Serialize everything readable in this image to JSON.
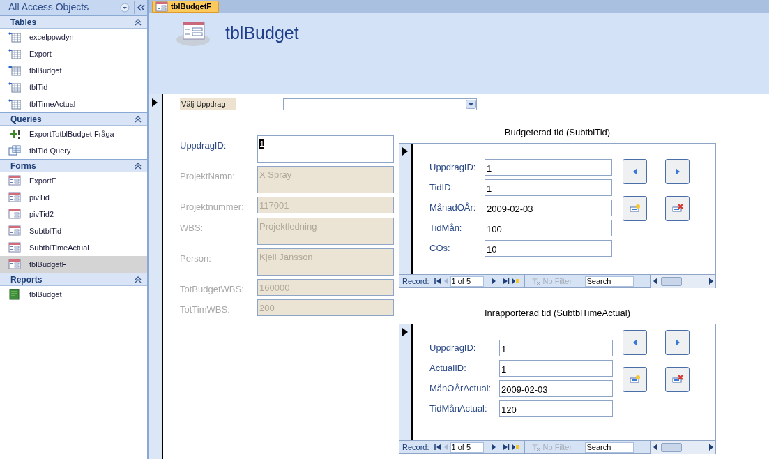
{
  "nav_pane": {
    "title": "All Access Objects",
    "groups": [
      {
        "name": "Tables",
        "items": [
          {
            "label": "excelppwdyn",
            "kind": "linked-table",
            "selected": false
          },
          {
            "label": "Export",
            "kind": "linked-table",
            "selected": false
          },
          {
            "label": "tblBudget",
            "kind": "linked-table",
            "selected": false
          },
          {
            "label": "tblTid",
            "kind": "linked-table",
            "selected": false
          },
          {
            "label": "tblTimeActual",
            "kind": "linked-table",
            "selected": false
          }
        ]
      },
      {
        "name": "Queries",
        "items": [
          {
            "label": "ExportTotblBudget Fråga",
            "kind": "append-query",
            "selected": false
          },
          {
            "label": "tblTid Query",
            "kind": "select-query",
            "selected": false
          }
        ]
      },
      {
        "name": "Forms",
        "items": [
          {
            "label": "ExportF",
            "kind": "form",
            "selected": false
          },
          {
            "label": "pivTid",
            "kind": "form",
            "selected": false
          },
          {
            "label": "pivTid2",
            "kind": "form",
            "selected": false
          },
          {
            "label": "SubtblTid",
            "kind": "form",
            "selected": false
          },
          {
            "label": "SubtblTimeActual",
            "kind": "form",
            "selected": false
          },
          {
            "label": "tblBudgetF",
            "kind": "form",
            "selected": true
          }
        ]
      },
      {
        "name": "Reports",
        "items": [
          {
            "label": "tblBudget",
            "kind": "report",
            "selected": false
          }
        ]
      }
    ]
  },
  "tabs": [
    {
      "label": "tblBudgetF",
      "selected": true
    }
  ],
  "form": {
    "title": "tblBudget",
    "combo": {
      "label": "Välj Uppdrag"
    },
    "fields": [
      {
        "label": "UppdragID:",
        "value": "1",
        "disabled": false,
        "multiline": true,
        "focused": true
      },
      {
        "label": "ProjektNamn:",
        "value": "X Spray",
        "disabled": true,
        "multiline": true,
        "focused": false
      },
      {
        "label": "Projektnummer:",
        "value": "117001",
        "disabled": true,
        "multiline": false,
        "focused": false
      },
      {
        "label": "WBS:",
        "value": "Projektledning",
        "disabled": true,
        "multiline": true,
        "focused": false
      },
      {
        "label": "Person:",
        "value": "Kjell Jansson",
        "disabled": true,
        "multiline": true,
        "focused": false
      },
      {
        "label": "TotBudgetWBS:",
        "value": "160000",
        "disabled": true,
        "multiline": false,
        "focused": false
      },
      {
        "label": "TotTimWBS:",
        "value": "200",
        "disabled": true,
        "multiline": false,
        "focused": false
      }
    ],
    "subforms": [
      {
        "title": "Budgeterad tid (SubtblTid)",
        "fields": [
          {
            "label": "UppdragID:",
            "value": "1"
          },
          {
            "label": "TidID:",
            "value": "1"
          },
          {
            "label": "MånadOÅr:",
            "value": "2009-02-03"
          },
          {
            "label": "TidMån:",
            "value": "100"
          },
          {
            "label": "COs:",
            "value": "10"
          }
        ],
        "navigation": {
          "record_label": "Record:",
          "position": "1 of 5",
          "filter": "No Filter",
          "search": "Search"
        }
      },
      {
        "title": "Inrapporterad tid (SubtblTimeActual)",
        "fields": [
          {
            "label": "UppdragID:",
            "value": "1"
          },
          {
            "label": "ActualID:",
            "value": "1"
          },
          {
            "label": "MånOÅrActual:",
            "value": "2009-02-03"
          },
          {
            "label": "TidMånActual:",
            "value": "120"
          }
        ],
        "navigation": {
          "record_label": "Record:",
          "position": "1 of 5",
          "filter": "No Filter",
          "search": "Search"
        }
      }
    ]
  }
}
